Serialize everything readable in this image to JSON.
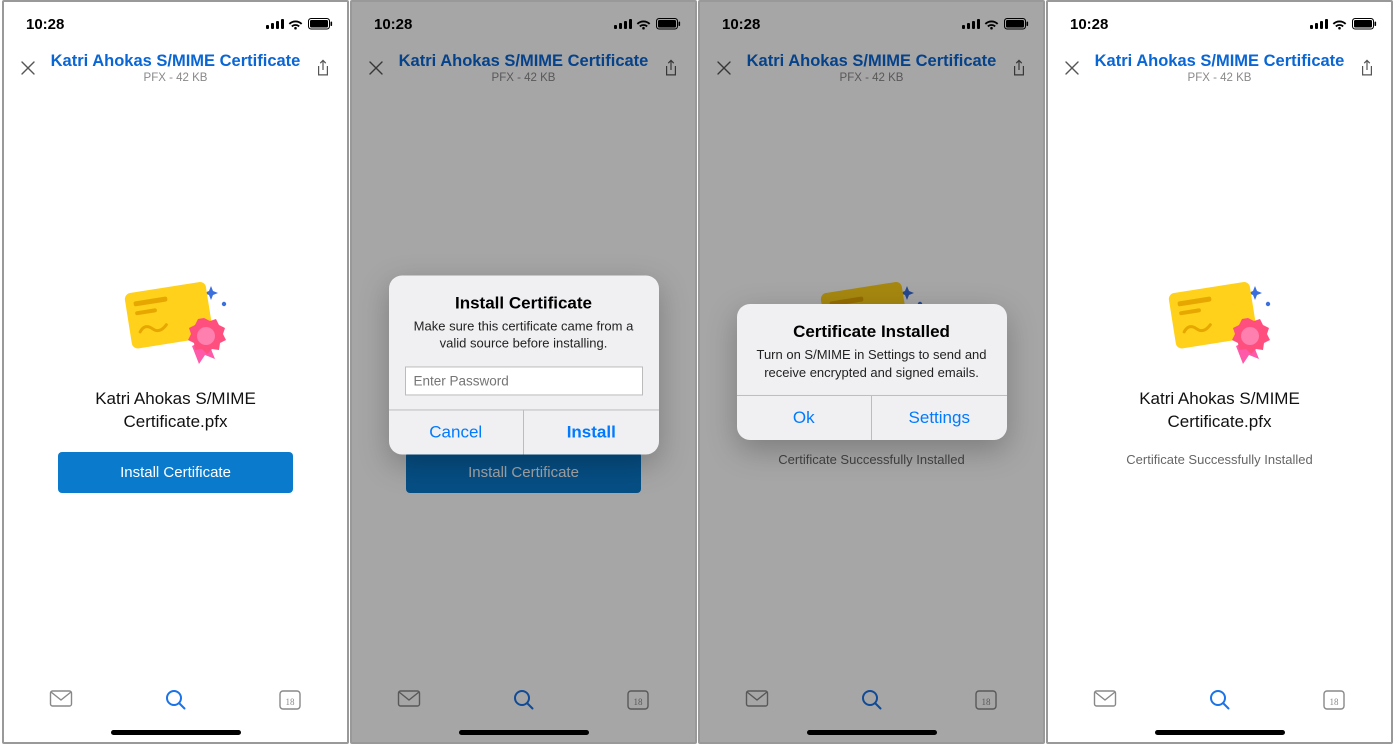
{
  "statusbar": {
    "time": "10:28"
  },
  "nav": {
    "title": "Katri Ahokas S/MIME Certificate",
    "subtitle": "PFX - 42 KB"
  },
  "file": {
    "name_line1": "Katri Ahokas S/MIME",
    "name_line2": "Certificate.pfx",
    "install_label": "Install Certificate",
    "success_label": "Certificate Successfully Installed"
  },
  "alert_install": {
    "title": "Install Certificate",
    "message": "Make sure this certificate came from a valid source before installing.",
    "placeholder": "Enter Password",
    "cancel": "Cancel",
    "install": "Install"
  },
  "alert_done": {
    "title": "Certificate Installed",
    "message": "Turn on S/MIME in Settings to send and receive encrypted and signed emails.",
    "ok": "Ok",
    "settings": "Settings"
  },
  "tabbar": {
    "calendar_day": "18"
  }
}
